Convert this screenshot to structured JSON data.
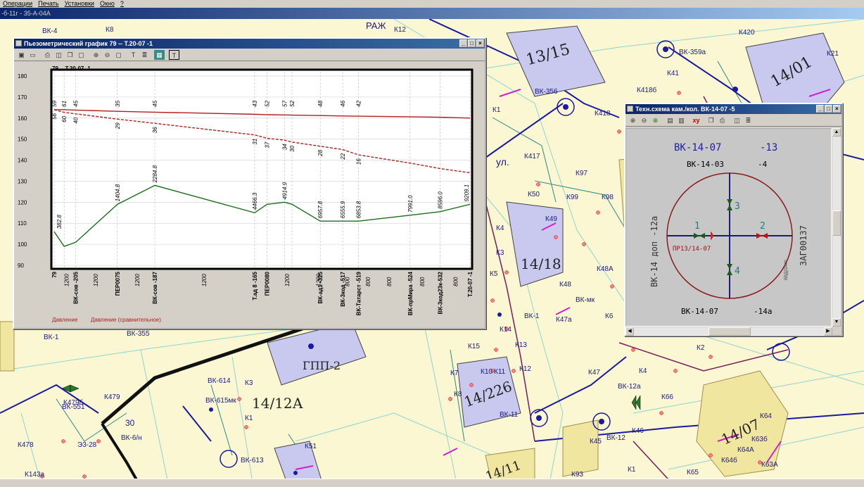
{
  "menu": [
    "Операции",
    "Печать",
    "Установки",
    "Окно",
    "?"
  ],
  "doc_title": "-б-11г - 35-А-04А",
  "map_labels": {
    "bk4": "ВК-4",
    "k8": "К8",
    "k12": "К12",
    "k12b": "К12",
    "raj": "РАЖ",
    "bldg_13_15": "13/15",
    "bldg_14_01": "14/01",
    "k420": "К420",
    "bk359a": "ВК-359а",
    "k21": "К21",
    "k41": "К41",
    "k418b": "К418б",
    "k418": "К418",
    "bk356": "ВК-356",
    "k1": "К1",
    "k417": "К417",
    "ul": "ул.",
    "k97": "К97",
    "k99": "К99",
    "k98": "К98",
    "k50": "К50",
    "k49": "К49",
    "k48": "К48",
    "k48a": "К48А",
    "bk_mk": "ВК-мк",
    "k47a": "К47а",
    "bk1": "ВК-1",
    "k6": "К6",
    "bldg_14_18": "14/18",
    "k4": "К4",
    "k5": "К5",
    "k3": "К3",
    "k14": "К14",
    "k13": "К13",
    "k15": "К15",
    "k10": "К10",
    "k11": "К11",
    "k7": "К7",
    "k8b": "К8",
    "bldg_14_226": "14/226",
    "bk11": "ВК-11",
    "k47": "К47",
    "bk12a": "ВК-12а",
    "bk12": "ВК-12",
    "k46": "К46",
    "k45": "К45",
    "k2": "К2",
    "k4b": "К4",
    "bldg_14_07": "14/07",
    "k64": "К64",
    "k63b": "К63б",
    "k64a": "К64А",
    "k64b": "К64б",
    "k63a": "К63А",
    "k65": "К65",
    "k93": "К93",
    "k1b": "К1",
    "bldg_14_11": "14/11",
    "gpp2": "ГПП-2",
    "bk614": "ВК-614",
    "bk615": "ВК-615мк",
    "bldg_14_12a": "14/12А",
    "bk613": "ВК-613",
    "k51": "К51",
    "bk355": "ВК-355",
    "bk_1": "ВК-1",
    "bk551": "ВК-551",
    "k479": "К479",
    "k479b": "К479б",
    "bk6n": "ВК-6/н",
    "n30": "30",
    "n28": "Э3-28",
    "k478": "К478",
    "k143a": "К143а",
    "k66": "К66"
  },
  "piezo": {
    "title": "Пьезометрический график 79 -- Т.20-07  -1",
    "subtitle": "79 -- Т.20-07  -1",
    "legend": [
      "Давление",
      "Давление (сравнительное)"
    ],
    "colors": {
      "pressure": "#b02020",
      "compare": "#b02020",
      "ground": "#1e6e1e"
    },
    "chart_data": {
      "type": "line",
      "title": "79 -- Т.20-07  -1",
      "ylim": [
        89,
        182
      ],
      "yticks": [
        90,
        100,
        110,
        120,
        130,
        140,
        150,
        160,
        170,
        180
      ],
      "grid": true,
      "x": [
        0,
        2.4,
        5.2,
        15.2,
        24.2,
        48.2,
        51.2,
        55.4,
        57.2,
        64.0,
        69.4,
        73.2,
        85.6,
        92.8,
        100
      ],
      "series": [
        {
          "name": "Давление",
          "style": "solid",
          "values": [
            164,
            164,
            163.8,
            163.2,
            162.8,
            161.8,
            161.6,
            161.5,
            161.4,
            161.2,
            161,
            160.9,
            160.6,
            160.4,
            160
          ]
        },
        {
          "name": "Давление (сравнительное)",
          "style": "dashed",
          "values": [
            164,
            162.7,
            162,
            159.5,
            157.5,
            152,
            150.4,
            149.5,
            148.6,
            146.6,
            145,
            142.5,
            138.6,
            136,
            134
          ]
        },
        {
          "name": "",
          "style": "solid",
          "values": [
            106,
            99,
            101,
            119,
            128,
            115,
            119,
            120,
            119,
            111,
            111,
            111,
            113.8,
            115.5,
            119
          ]
        }
      ],
      "point_labels_top": [
        "59",
        "61",
        "45",
        "35",
        "45",
        "43",
        "52",
        "57",
        "52",
        "48",
        "46",
        "42"
      ],
      "point_labels_mid": [
        "56",
        "60",
        "40",
        "29",
        "36",
        "31",
        "37",
        "34",
        "30",
        "28",
        "22",
        "16"
      ],
      "ground_labels": [
        "382.8",
        "1404.8",
        "2284.8",
        "4466.3",
        "4914.9",
        "6957.8",
        "6555.9",
        "6853.8",
        "7991.0",
        "8596.0",
        "9209.1"
      ],
      "dist_labels": [
        "1200",
        "1200",
        "1200",
        "1200",
        "1200",
        "1200",
        "800",
        "800",
        "800",
        "800",
        "800"
      ],
      "stations": [
        "79",
        "ВК-сов  -205",
        "ПЕР0075",
        "ВК-сов  -187",
        "Т.ад 8  -165",
        "ПЕР0080",
        "ВК-ад1  -325",
        "ВК-3код  -517",
        "ВК-Татарст  -519",
        "ВК-прМира  -524",
        "ВК-3код23к-532",
        "Т.20-07  -1"
      ]
    }
  },
  "scheme": {
    "title": "Техн.схема кам./кол. ВК-14-07  -5",
    "header": "ВК-14-07",
    "header_num": "-13",
    "top": "ВК-14-03",
    "top_num": "-4",
    "bottom": "ВК-14-07",
    "bottom_num": "-14а",
    "left": "ВК-14 доп  -12а",
    "right": "ЗАГ00137",
    "label_in": "ПР13/14-07",
    "stamp": "ВВД22440",
    "nums": [
      "1",
      "2",
      "3",
      "4"
    ]
  }
}
